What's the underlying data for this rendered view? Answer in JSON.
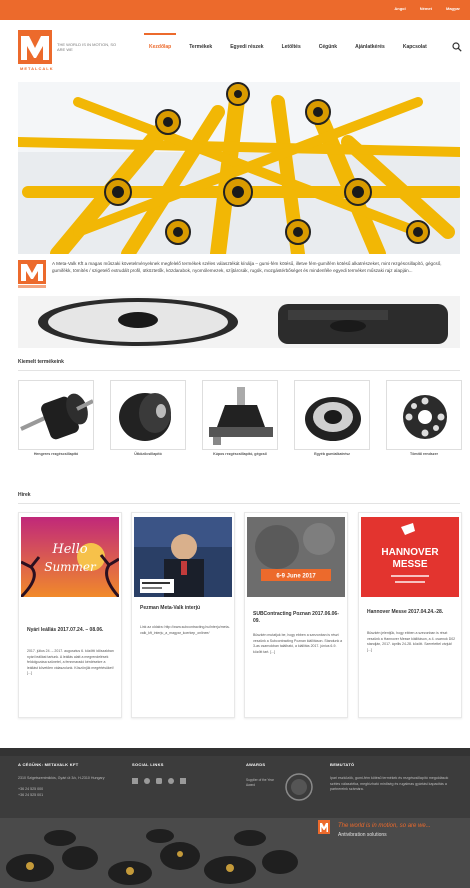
{
  "topbar": {
    "links": [
      "Angol",
      "Német",
      "Magyar"
    ]
  },
  "header": {
    "logo_word": "METALCALK",
    "slogan": "THE WORLD IS IN MOTION, SO ARE WE",
    "nav": [
      "Kezdőlap",
      "Termékek",
      "Egyedi részek",
      "Letöltés",
      "Cégünk",
      "Ajánlatkérés",
      "Kapcsolat"
    ],
    "active_nav": 0,
    "accent_color": "#ec6a2c"
  },
  "intro": {
    "text": "A Meta-Valk Kft a magas műszaki követelményeknek megfelelő termékek széles választékát kínálja – gumi-fém kötésű, illetve fém-gumifém kötésű alkatrészeket, mint rezgéscsillapító, gégcső, gumifékk, tömítés / szigetelő extrudált profil, ütköztetők, közdarabok, nyomólemezek, szíjtárcsák, rugók, mozgástérbőséget és mindenféle egyedi terméket műszaki rajz alapján..."
  },
  "products_section": {
    "title": "Kiemelt termékeink",
    "items": [
      {
        "label": "Hengeres rezgéscsillapító"
      },
      {
        "label": "Ütközőcsillapító"
      },
      {
        "label": "Kúpos rezgéscsillapító, gégcső"
      },
      {
        "label": "Egyéb gumialkatrész"
      },
      {
        "label": "Tömítő rendszer"
      }
    ]
  },
  "news_section": {
    "title": "Hírek",
    "cards": [
      {
        "title": "Nyári leállás 2017.07.24. – 08.06.",
        "text": "2017. július 24. – 2017. augusztus 6. közötti időszakban nyári leállást tartunk. A leállás alatt a megrendelések feldolgozása szünetel, a fennmaradó kérdésekre a leállást követően válaszolunk. Köszönjük megértésüket! [...]",
        "image_caption_line1": "Hello",
        "image_caption_line2": "Summer"
      },
      {
        "title": "Pezman Meta-Valk interjú",
        "text": "Link az oldalra: http://www.subcontracting.hu/interju/meta-valk_kft_interju_a_magyar_koerkep_onlinee/",
        "image_caption_line1": "",
        "image_caption_line2": ""
      },
      {
        "title": "SUBContracting Poznan 2017.06.06-09.",
        "text": "Büszkén mutatjuk be, hogy ebben a szezonban is részt veszünk a Subcontracting Poznan kiállításon. Standunk a 3-as csarnokban található, a kiállítás 2017. június 6-9. között tart. [...]",
        "image_caption_line1": "6-9 June 2017",
        "image_caption_line2": ""
      },
      {
        "title": "Hannover Messe 2017.04.24.-28.",
        "text": "Büszkén jelentjük, hogy ebben a szezonban is részt veszünk a Hannover Messe kiállításon, a 4. csarnok D02 standján, 2017. április 24-28. között. Szeretettel várjuk! [...]",
        "image_caption_line1": "HANNOVER",
        "image_caption_line2": "MESSE"
      }
    ]
  },
  "footer": {
    "columns": [
      {
        "title": "A CÉGÜNK: METAVALK KFT",
        "text": "2310 Szigetszentmiklós, Gyári út 3/c, H-2310 Hungary\n\n+36 24 525 000\n+36 24 525 001"
      },
      {
        "title": "SOCIAL LINKS",
        "text": ""
      },
      {
        "title": "AWARDS",
        "text": "Supplier of the Year Award"
      },
      {
        "title": "BEMUTATÓ",
        "text": "Ipari eszközök, gumi-fém kötésű termékek és rezgéscsillapító megoldások széles választéka, megbízható minőség és rugalmas gyártási kapacitás a partnereink számára."
      }
    ],
    "banner_line1": "The world is in motion, so are we...",
    "banner_line2": "Antivibration solutions"
  }
}
